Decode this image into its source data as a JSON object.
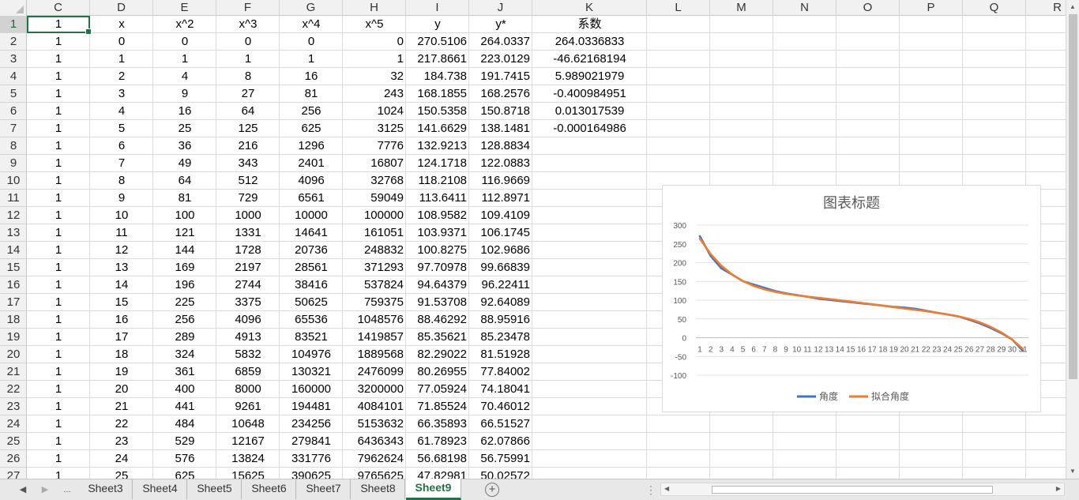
{
  "sheet": {
    "columns": [
      "C",
      "D",
      "E",
      "F",
      "G",
      "H",
      "I",
      "J",
      "K",
      "L",
      "M",
      "N",
      "O",
      "P",
      "Q",
      "R"
    ],
    "row_numbers": [
      "1",
      "2",
      "3",
      "4",
      "5",
      "6",
      "7",
      "8",
      "9",
      "10",
      "11",
      "12",
      "13",
      "14",
      "15",
      "16",
      "17",
      "18",
      "19",
      "20",
      "21",
      "22",
      "23",
      "24",
      "25",
      "26",
      "27"
    ],
    "header_row": [
      "1",
      "x",
      "x^2",
      "x^3",
      "x^4",
      "x^5",
      "y",
      "y*",
      "系数"
    ],
    "rows": [
      [
        "1",
        "0",
        "0",
        "0",
        "0",
        "0",
        "270.5106",
        "264.0337",
        "264.0336833"
      ],
      [
        "1",
        "1",
        "1",
        "1",
        "1",
        "1",
        "217.8661",
        "223.0129",
        "-46.62168194"
      ],
      [
        "1",
        "2",
        "4",
        "8",
        "16",
        "32",
        "184.738",
        "191.7415",
        "5.989021979"
      ],
      [
        "1",
        "3",
        "9",
        "27",
        "81",
        "243",
        "168.1855",
        "168.2576",
        "-0.400984951"
      ],
      [
        "1",
        "4",
        "16",
        "64",
        "256",
        "1024",
        "150.5358",
        "150.8718",
        "0.013017539"
      ],
      [
        "1",
        "5",
        "25",
        "125",
        "625",
        "3125",
        "141.6629",
        "138.1481",
        "-0.000164986"
      ],
      [
        "1",
        "6",
        "36",
        "216",
        "1296",
        "7776",
        "132.9213",
        "128.8834",
        ""
      ],
      [
        "1",
        "7",
        "49",
        "343",
        "2401",
        "16807",
        "124.1718",
        "122.0883",
        ""
      ],
      [
        "1",
        "8",
        "64",
        "512",
        "4096",
        "32768",
        "118.2108",
        "116.9669",
        ""
      ],
      [
        "1",
        "9",
        "81",
        "729",
        "6561",
        "59049",
        "113.6411",
        "112.8971",
        ""
      ],
      [
        "1",
        "10",
        "100",
        "1000",
        "10000",
        "100000",
        "108.9582",
        "109.4109",
        ""
      ],
      [
        "1",
        "11",
        "121",
        "1331",
        "14641",
        "161051",
        "103.9371",
        "106.1745",
        ""
      ],
      [
        "1",
        "12",
        "144",
        "1728",
        "20736",
        "248832",
        "100.8275",
        "102.9686",
        ""
      ],
      [
        "1",
        "13",
        "169",
        "2197",
        "28561",
        "371293",
        "97.70978",
        "99.66839",
        ""
      ],
      [
        "1",
        "14",
        "196",
        "2744",
        "38416",
        "537824",
        "94.64379",
        "96.22411",
        ""
      ],
      [
        "1",
        "15",
        "225",
        "3375",
        "50625",
        "759375",
        "91.53708",
        "92.64089",
        ""
      ],
      [
        "1",
        "16",
        "256",
        "4096",
        "65536",
        "1048576",
        "88.46292",
        "88.95916",
        ""
      ],
      [
        "1",
        "17",
        "289",
        "4913",
        "83521",
        "1419857",
        "85.35621",
        "85.23478",
        ""
      ],
      [
        "1",
        "18",
        "324",
        "5832",
        "104976",
        "1889568",
        "82.29022",
        "81.51928",
        ""
      ],
      [
        "1",
        "19",
        "361",
        "6859",
        "130321",
        "2476099",
        "80.26955",
        "77.84002",
        ""
      ],
      [
        "1",
        "20",
        "400",
        "8000",
        "160000",
        "3200000",
        "77.05924",
        "74.18041",
        ""
      ],
      [
        "1",
        "21",
        "441",
        "9261",
        "194481",
        "4084101",
        "71.85524",
        "70.46012",
        ""
      ],
      [
        "1",
        "22",
        "484",
        "10648",
        "234256",
        "5153632",
        "66.35893",
        "66.51527",
        ""
      ],
      [
        "1",
        "23",
        "529",
        "12167",
        "279841",
        "6436343",
        "61.78923",
        "62.07866",
        ""
      ],
      [
        "1",
        "24",
        "576",
        "13824",
        "331776",
        "7962624",
        "56.68198",
        "56.75991",
        ""
      ],
      [
        "1",
        "25",
        "625",
        "15625",
        "390625",
        "9765625",
        "47.82981",
        "50.02572",
        ""
      ]
    ]
  },
  "chart_data": {
    "type": "line",
    "title": "图表标题",
    "categories": [
      "1",
      "2",
      "3",
      "4",
      "5",
      "6",
      "7",
      "8",
      "9",
      "10",
      "11",
      "12",
      "13",
      "14",
      "15",
      "16",
      "17",
      "18",
      "19",
      "20",
      "21",
      "22",
      "23",
      "24",
      "25",
      "26",
      "27",
      "28",
      "29",
      "30",
      "31"
    ],
    "series": [
      {
        "name": "角度",
        "color": "#4472c4",
        "values": [
          270.5,
          217.9,
          184.7,
          168.2,
          150.5,
          141.7,
          132.9,
          124.2,
          118.2,
          113.6,
          109.0,
          103.9,
          100.8,
          97.7,
          94.6,
          91.5,
          88.5,
          85.4,
          82.3,
          80.3,
          77.1,
          71.9,
          66.4,
          61.8,
          56.7,
          47.8,
          38,
          26,
          12,
          -5,
          -35
        ]
      },
      {
        "name": "拟合角度",
        "color": "#ed7d31",
        "values": [
          264.0,
          223.0,
          191.7,
          168.3,
          150.9,
          138.1,
          128.9,
          122.1,
          117.0,
          112.9,
          109.4,
          106.2,
          103.0,
          99.7,
          96.2,
          92.6,
          89.0,
          85.2,
          81.5,
          77.8,
          74.2,
          70.5,
          66.5,
          62.1,
          56.8,
          50.0,
          41,
          29,
          14,
          -5,
          -30
        ]
      }
    ],
    "ylim": [
      -100,
      300
    ],
    "yticks": [
      "300",
      "250",
      "200",
      "150",
      "100",
      "50",
      "0",
      "-50",
      "-100"
    ],
    "grid": true,
    "legend": "bottom"
  },
  "tabs": {
    "nav_prev": "◀",
    "nav_next": "▶",
    "more": "...",
    "items": [
      "Sheet3",
      "Sheet4",
      "Sheet5",
      "Sheet6",
      "Sheet7",
      "Sheet8",
      "Sheet9"
    ],
    "active": "Sheet9",
    "add": "+"
  }
}
